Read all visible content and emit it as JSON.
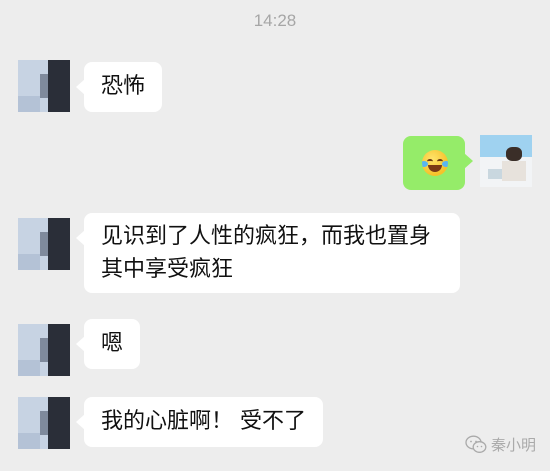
{
  "status": {
    "time": "14:28"
  },
  "messages": [
    {
      "sender": "other",
      "text": "恐怖"
    },
    {
      "sender": "self",
      "content": "emoji",
      "emoji": "laughing-crying-emoji-icon"
    },
    {
      "sender": "other",
      "lines": [
        "见识到了人性的疯狂，而我也置身",
        "其中享受疯狂"
      ]
    },
    {
      "sender": "other",
      "text": "嗯"
    },
    {
      "sender": "other",
      "text": "我的心脏啊！ 受不了"
    }
  ],
  "watermark": {
    "text": "秦小明",
    "icon": "wechat-icon"
  },
  "colors": {
    "background": "#ededed",
    "bubble_incoming": "#ffffff",
    "bubble_outgoing": "#95ec69",
    "timestamp": "#a6a6a6"
  }
}
